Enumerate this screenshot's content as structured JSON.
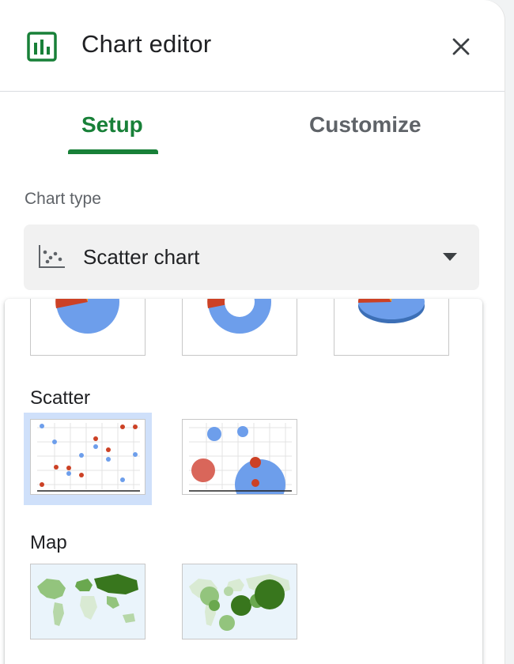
{
  "header": {
    "title": "Chart editor",
    "close_icon": "close-icon",
    "app_icon": "chart-editor-icon"
  },
  "tabs": [
    {
      "label": "Setup",
      "active": true
    },
    {
      "label": "Customize",
      "active": false
    }
  ],
  "chart_type": {
    "label": "Chart type",
    "selected": "Scatter chart",
    "icon": "scatter-chart-icon"
  },
  "dropdown": {
    "pie_row": [
      "pie-chart",
      "doughnut-chart",
      "3d-pie-chart"
    ],
    "sections": [
      {
        "label": "Scatter",
        "items": [
          "scatter-chart",
          "bubble-chart"
        ],
        "selected_index": 0
      },
      {
        "label": "Map",
        "items": [
          "geo-chart",
          "geo-chart-with-markers"
        ]
      }
    ]
  },
  "colors": {
    "accent": "#188038",
    "selected_bg": "#cfe0fa",
    "blue": "#6d9eeb",
    "red": "#cc4125",
    "orange": "#f6a623",
    "map_dark": "#38761d",
    "map_light": "#93c47d"
  }
}
